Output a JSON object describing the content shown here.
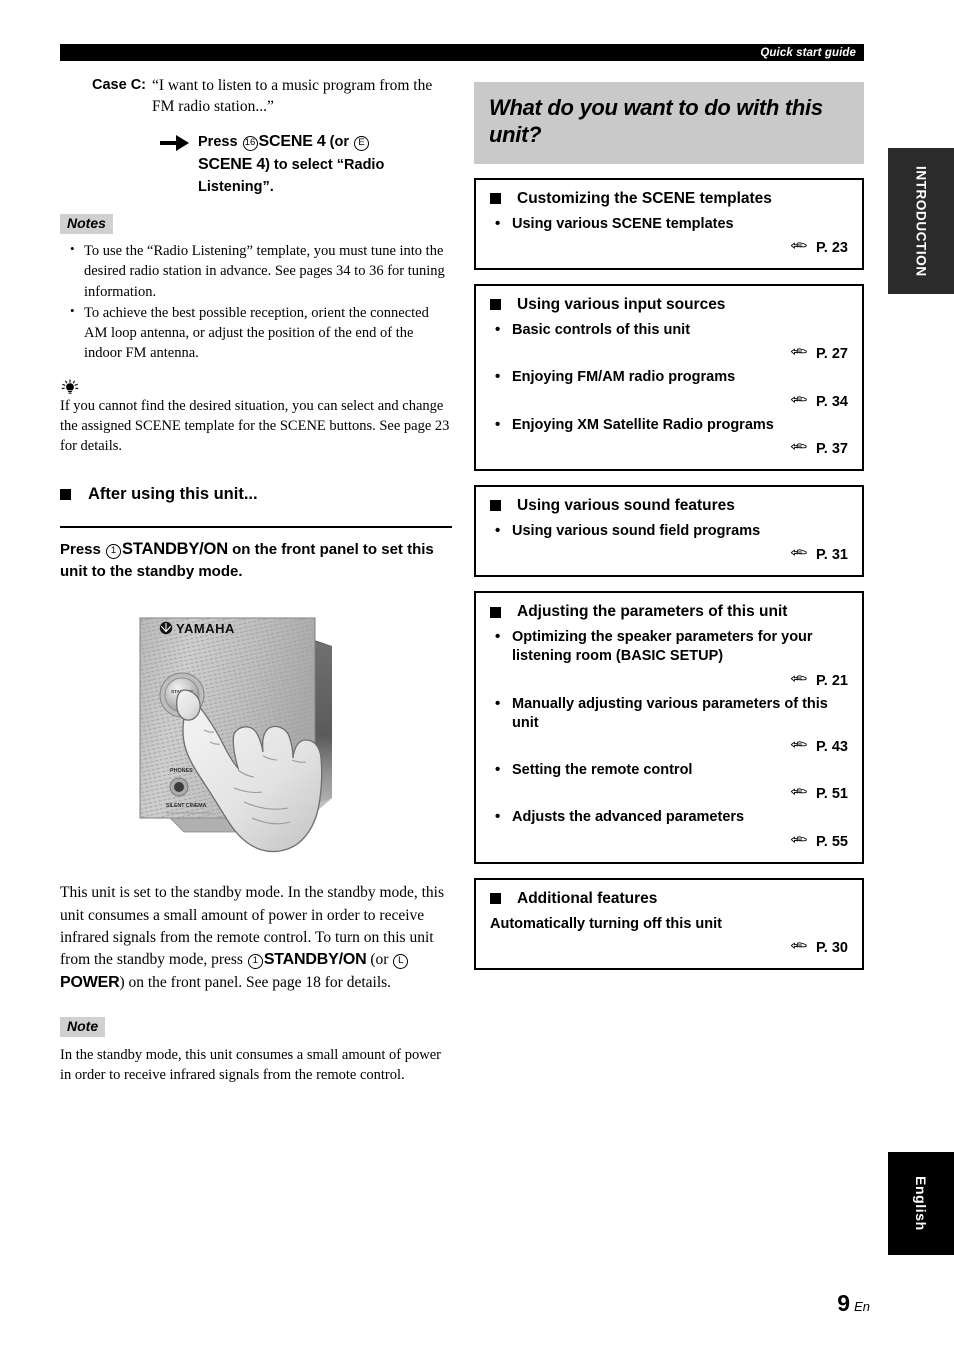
{
  "header": {
    "title": "Quick start guide"
  },
  "side_tabs": {
    "introduction": "INTRODUCTION",
    "english": "English"
  },
  "footer": {
    "page_number": "9",
    "lang_suffix": "En"
  },
  "left_column": {
    "case": {
      "label": "Case C:",
      "text": "“I want to listen to a music program from the FM radio station...”"
    },
    "press_instruction": {
      "prefix": "Press ",
      "num_1": "16",
      "button_1": "SCENE 4",
      "mid": " (or ",
      "num_2": "E",
      "button_2": "SCENE 4",
      "suffix": ") to select “Radio Listening”."
    },
    "notes_label": "Notes",
    "notes": [
      "To use the “Radio Listening” template, you must tune into the desired radio station in advance. See pages 34 to 36 for tuning information.",
      "To achieve the best possible reception, orient the connected AM loop antenna, or adjust the position of the end of the indoor FM antenna."
    ],
    "tip": "If you cannot find the desired situation, you can select and change the assigned SCENE template for the SCENE buttons. See page 23 for details.",
    "section_heading": "After using this unit...",
    "lead_paragraph": {
      "prefix": "Press ",
      "num": "1",
      "button": "STANDBY/ON",
      "suffix": " on the front panel to set this unit to the standby mode."
    },
    "illustration": {
      "brand": "YAMAHA",
      "button_label_top": "STANDBY",
      "button_label_bottom": "/ON",
      "jack_label": "PHONES",
      "panel_label": "SILENT CINEMA"
    },
    "body_paragraph": {
      "part1": "This unit is set to the standby mode. In the standby mode, this unit consumes a small amount of power in order to receive infrared signals from the remote control. To turn on this unit from the standby mode, press ",
      "num_1": "1",
      "button_1": "STANDBY/ON",
      "mid": " (or ",
      "num_2": "L",
      "button_2": "POWER",
      "part2": ") on the front panel. See page 18 for details."
    },
    "note_label": "Note",
    "note_body": "In the standby mode, this unit consumes a small amount of power in order to receive infrared signals from the remote control."
  },
  "right_column": {
    "title": "What do you want to do with this unit?",
    "ref_icon": "pointing-hand-icon",
    "boxes": [
      {
        "heading": "Customizing the SCENE templates",
        "items": [
          {
            "bullet": true,
            "text": "Using various SCENE templates",
            "ref": "P. 23"
          }
        ]
      },
      {
        "heading": "Using various input sources",
        "items": [
          {
            "bullet": true,
            "text": "Basic controls of this unit",
            "ref": "P. 27"
          },
          {
            "bullet": true,
            "text": "Enjoying FM/AM radio programs",
            "ref": "P. 34"
          },
          {
            "bullet": true,
            "text": "Enjoying XM Satellite Radio programs",
            "ref": "P. 37"
          }
        ]
      },
      {
        "heading": "Using various sound features",
        "items": [
          {
            "bullet": true,
            "text": "Using various sound field programs",
            "ref": "P. 31"
          }
        ]
      },
      {
        "heading": "Adjusting the parameters of this unit",
        "items": [
          {
            "bullet": true,
            "text": "Optimizing the speaker parameters for your listening room (BASIC SETUP)",
            "ref": "P. 21"
          },
          {
            "bullet": true,
            "text": "Manually adjusting various parameters of this unit",
            "ref": "P. 43"
          },
          {
            "bullet": true,
            "text": "Setting the remote control",
            "ref": "P. 51"
          },
          {
            "bullet": true,
            "text": "Adjusts the advanced parameters",
            "ref": "P. 55"
          }
        ]
      },
      {
        "heading": "Additional features",
        "items": [
          {
            "bullet": false,
            "text": "Automatically turning off this unit",
            "ref": "P. 30"
          }
        ]
      }
    ]
  },
  "colors": {
    "accent_black": "#000000",
    "title_gray": "#c9c9c9",
    "badge_gray": "#d0d0d0",
    "tab_gray": "#2b2b2b"
  }
}
